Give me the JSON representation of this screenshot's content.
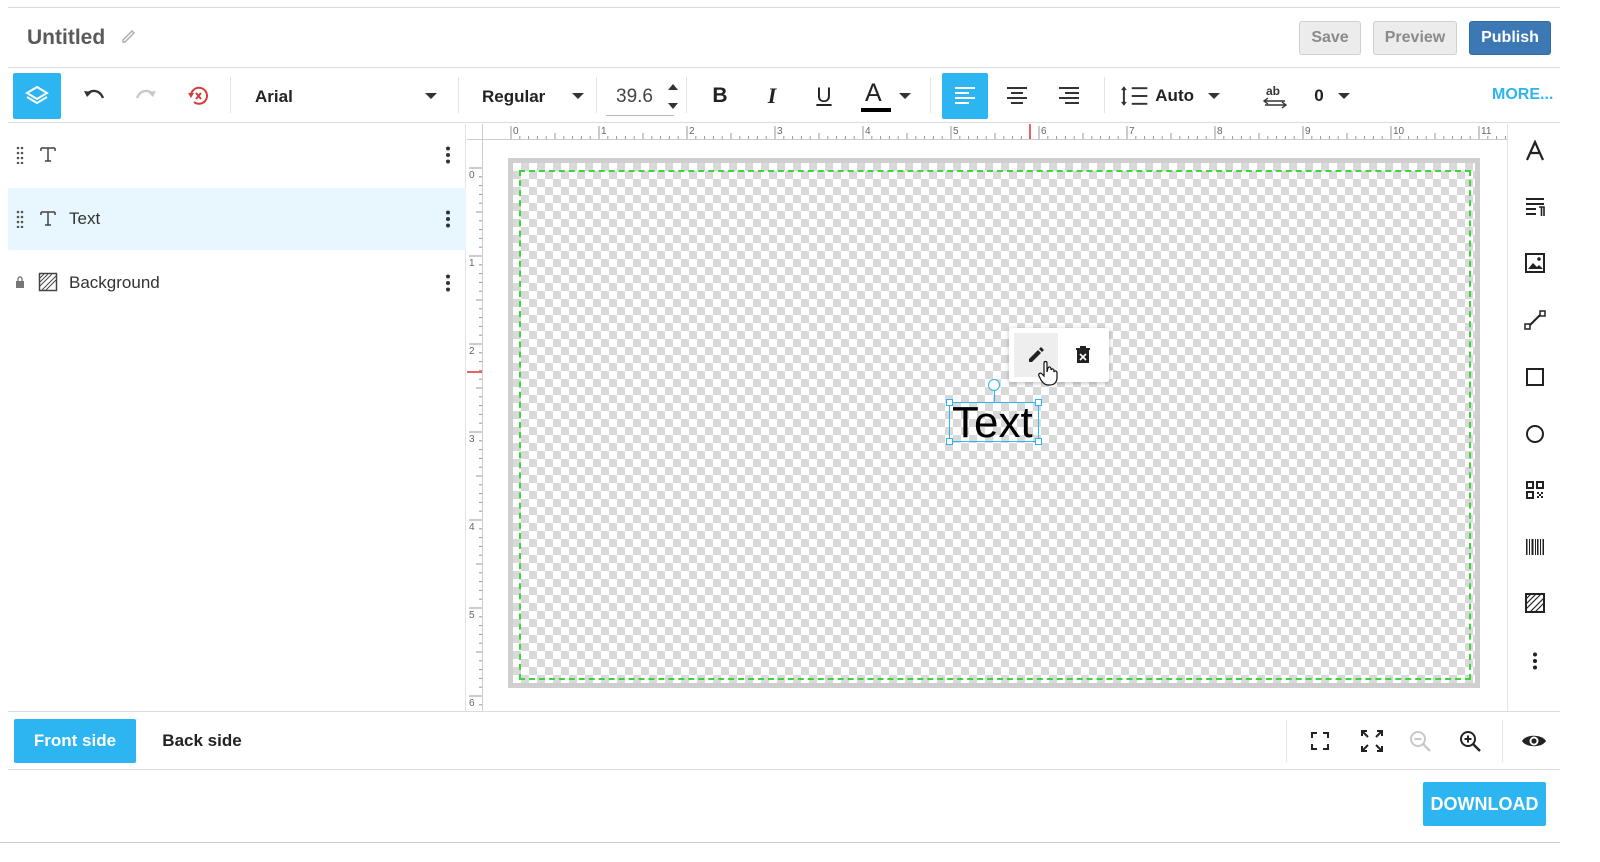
{
  "header": {
    "title": "Untitled",
    "save_label": "Save",
    "preview_label": "Preview",
    "publish_label": "Publish"
  },
  "toolbar": {
    "font_family": "Arial",
    "font_style": "Regular",
    "font_size": "39.6",
    "line_height": "Auto",
    "letter_spacing": "0",
    "more_label": "MORE...",
    "bold_glyph": "B",
    "italic_glyph": "I",
    "underline_glyph": "U",
    "color_glyph": "A",
    "text_color": "#000000",
    "active_align": "left"
  },
  "layers": [
    {
      "name": "",
      "type": "text-icon",
      "locked": false,
      "selected": false
    },
    {
      "name": "Text",
      "type": "text-icon",
      "locked": false,
      "selected": true
    },
    {
      "name": "Background",
      "type": "background-icon",
      "locked": true,
      "selected": false
    }
  ],
  "ruler": {
    "top_ticks": [
      "0",
      "1",
      "2",
      "3",
      "4",
      "5",
      "6",
      "7",
      "8",
      "9",
      "10",
      "11"
    ],
    "left_ticks": [
      "0",
      "1",
      "2",
      "3",
      "4",
      "5",
      "6"
    ]
  },
  "canvas": {
    "text_object": "Text",
    "safe_zone_color": "#3bd63b",
    "selection_color": "#2cb5f0"
  },
  "right_tools": [
    "text-tool-icon",
    "paragraph-tool-icon",
    "image-tool-icon",
    "line-tool-icon",
    "rectangle-tool-icon",
    "ellipse-tool-icon",
    "qr-code-tool-icon",
    "barcode-tool-icon",
    "background-tool-icon",
    "more-tools-icon"
  ],
  "bottom": {
    "front_label": "Front side",
    "back_label": "Back side"
  },
  "download_label": "DOWNLOAD",
  "colors": {
    "accent": "#2cb5f0",
    "publish": "#3c78b4",
    "undo_reset": "#d43c3c"
  }
}
